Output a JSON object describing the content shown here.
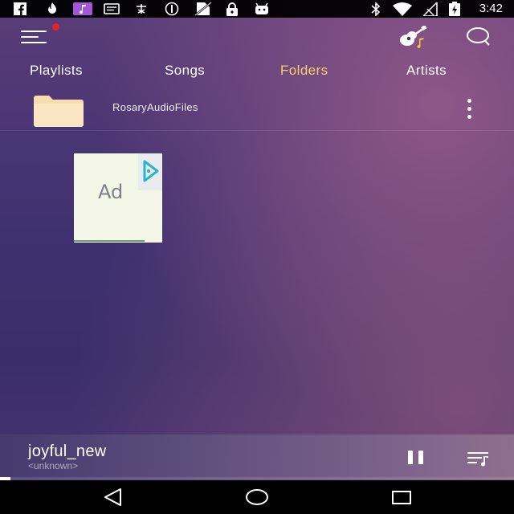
{
  "status_bar": {
    "time": "3:42",
    "left_icons": [
      "facebook-icon",
      "fire-icon",
      "music-app-icon",
      "message-icon",
      "cast-icon",
      "sync-icon",
      "no-sim-icon",
      "lock-icon",
      "android-icon"
    ],
    "right_icons": [
      "bluetooth-icon",
      "wifi-icon",
      "no-signal-icon",
      "battery-charging-icon"
    ]
  },
  "header": {
    "menu_icon": "hamburger-menu-icon",
    "notification_dot_color": "#e8202a",
    "guitar_icon": "guitar-icon",
    "search_icon": "search-icon"
  },
  "tabs": [
    {
      "label": "Playlists",
      "active": false
    },
    {
      "label": "Songs",
      "active": false
    },
    {
      "label": "Folders",
      "active": true
    },
    {
      "label": "Artists",
      "active": false
    }
  ],
  "active_tab_color": "#f4d06b",
  "folders": [
    {
      "name": "RosaryAudioFiles",
      "icon": "folder-icon"
    }
  ],
  "ad": {
    "label": "Ad",
    "choice_icon": "ad-choices-icon"
  },
  "player": {
    "title": "joyful_new",
    "artist": "<unknown>",
    "progress": 0.02,
    "pause_icon": "pause-icon",
    "queue_icon": "queue-icon"
  },
  "nav_bar": {
    "back_icon": "back-icon",
    "home_icon": "home-icon",
    "recents_icon": "recents-icon"
  }
}
